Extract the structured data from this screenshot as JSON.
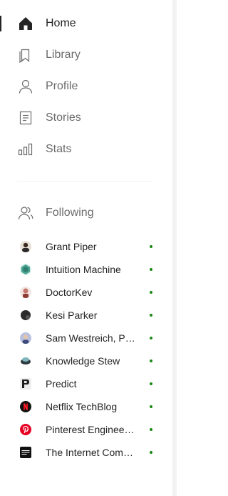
{
  "nav": {
    "items": [
      {
        "label": "Home",
        "icon": "home-icon",
        "active": true
      },
      {
        "label": "Library",
        "icon": "bookmark-icon"
      },
      {
        "label": "Profile",
        "icon": "profile-icon"
      },
      {
        "label": "Stories",
        "icon": "stories-icon"
      },
      {
        "label": "Stats",
        "icon": "stats-icon"
      }
    ]
  },
  "following": {
    "label": "Following",
    "icon": "following-icon",
    "items": [
      {
        "name": "Grant Piper",
        "avatar_color": "#d9cfc4"
      },
      {
        "name": "Intuition Machine",
        "avatar_color": "#4aa392"
      },
      {
        "name": "DoctorKev",
        "avatar_color": "#c4776c"
      },
      {
        "name": "Kesi Parker",
        "avatar_color": "#2b2b2b"
      },
      {
        "name": "Sam Westreich, PhD",
        "avatar_color": "#7b86b8"
      },
      {
        "name": "Knowledge Stew",
        "avatar_color": "#3e7a82"
      },
      {
        "name": "Predict",
        "avatar_color": "#1f1f1f"
      },
      {
        "name": "Netflix TechBlog",
        "avatar_color": "#e50914"
      },
      {
        "name": "Pinterest Engineer…",
        "avatar_color": "#e60023"
      },
      {
        "name": "The Internet Comp…",
        "avatar_color": "#111111"
      }
    ],
    "dot_color": "#1a8917"
  }
}
